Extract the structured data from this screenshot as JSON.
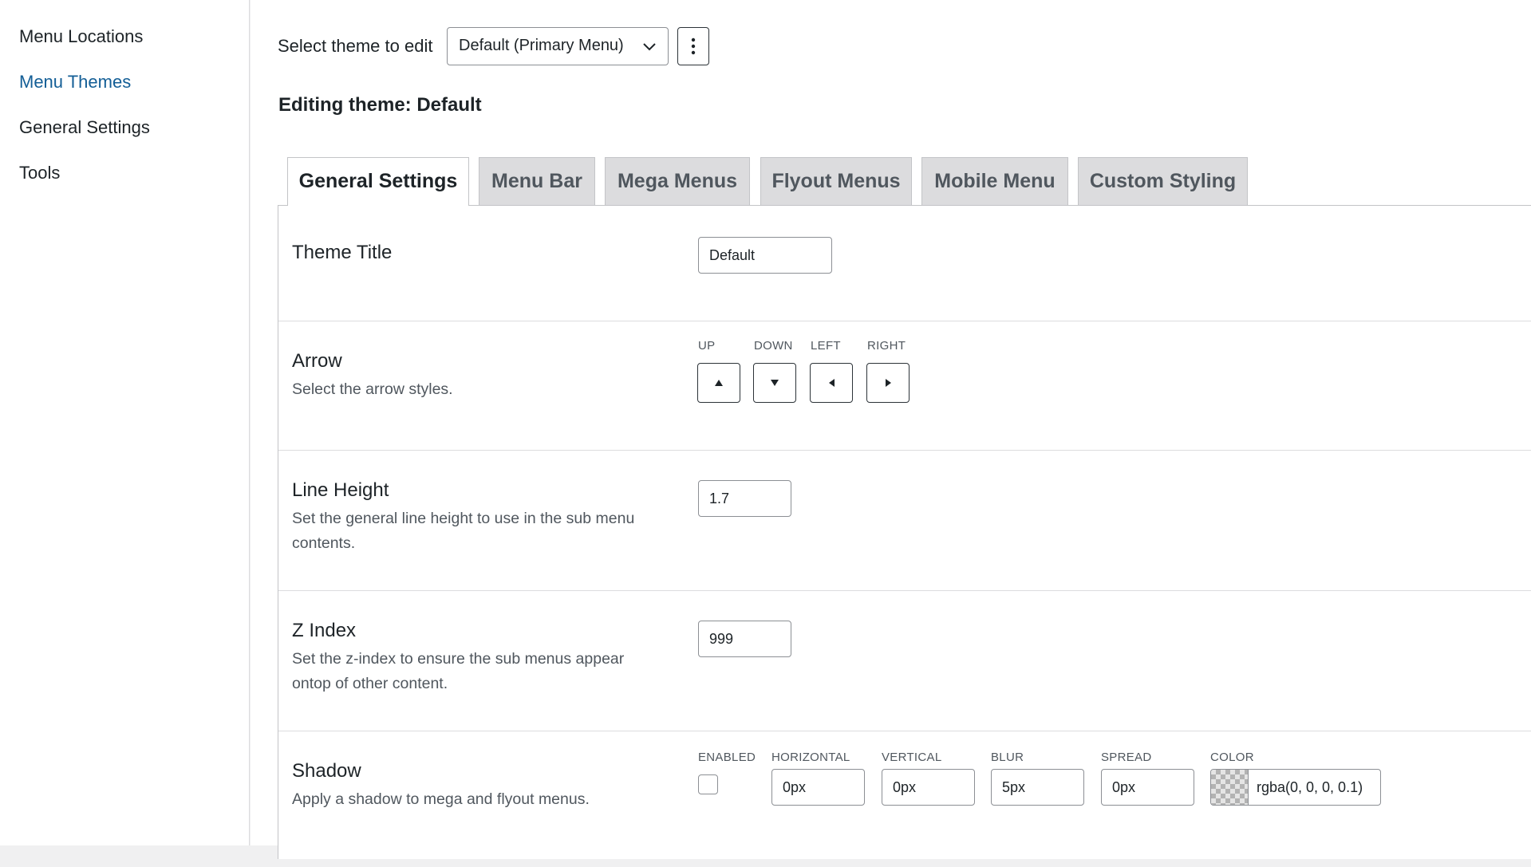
{
  "sidebar": {
    "items": [
      {
        "label": "Menu Locations",
        "active": false
      },
      {
        "label": "Menu Themes",
        "active": true
      },
      {
        "label": "General Settings",
        "active": false
      },
      {
        "label": "Tools",
        "active": false
      }
    ]
  },
  "toolbar": {
    "select_label": "Select theme to edit",
    "selected_theme": "Default (Primary Menu)",
    "select_icon": "chevron-down-icon",
    "more_icon": "vertical-ellipsis-icon"
  },
  "editing_title": "Editing theme: Default",
  "tabs": [
    {
      "label": "General Settings",
      "active": true
    },
    {
      "label": "Menu Bar",
      "active": false
    },
    {
      "label": "Mega Menus",
      "active": false
    },
    {
      "label": "Flyout Menus",
      "active": false
    },
    {
      "label": "Mobile Menu",
      "active": false
    },
    {
      "label": "Custom Styling",
      "active": false
    }
  ],
  "settings": {
    "theme_title": {
      "title": "Theme Title",
      "value": "Default"
    },
    "arrow": {
      "title": "Arrow",
      "description": "Select the arrow styles.",
      "labels": {
        "up": "UP",
        "down": "DOWN",
        "left": "LEFT",
        "right": "RIGHT"
      },
      "icons": {
        "up": "arrow-up-icon",
        "down": "arrow-down-icon",
        "left": "arrow-left-icon",
        "right": "arrow-right-icon"
      }
    },
    "line_height": {
      "title": "Line Height",
      "description": "Set the general line height to use in the sub menu contents.",
      "value": "1.7"
    },
    "z_index": {
      "title": "Z Index",
      "description": "Set the z-index to ensure the sub menus appear ontop of other content.",
      "value": "999"
    },
    "shadow": {
      "title": "Shadow",
      "description": "Apply a shadow to mega and flyout menus.",
      "labels": {
        "enabled": "ENABLED",
        "horizontal": "HORIZONTAL",
        "vertical": "VERTICAL",
        "blur": "BLUR",
        "spread": "SPREAD",
        "color": "COLOR"
      },
      "enabled": false,
      "horizontal": "0px",
      "vertical": "0px",
      "blur": "5px",
      "spread": "0px",
      "color": "rgba(0, 0, 0, 0.1)"
    }
  },
  "colors": {
    "accent": "#135e96",
    "tab_inactive_bg": "#dcdcde",
    "border": "#8c8f94"
  }
}
